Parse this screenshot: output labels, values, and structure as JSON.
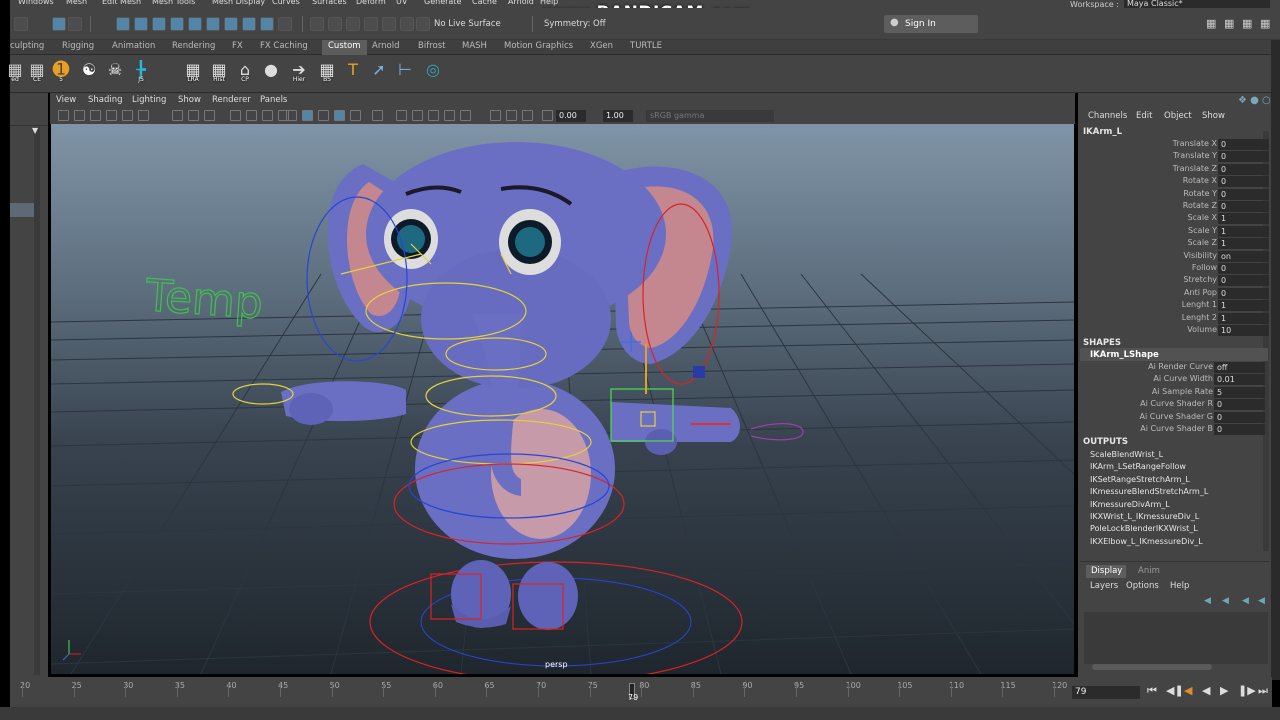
{
  "menu_bar": [
    "Windows",
    "Mesh",
    "Edit Mesh",
    "Mesh Tools",
    "Mesh Display",
    "Curves",
    "Surfaces",
    "Deform",
    "UV",
    "Generate",
    "Cache",
    "Arnold",
    "Help"
  ],
  "watermark": "www.BANDICAM.com",
  "workspace": {
    "label": "Workspace :",
    "value": "Maya Classic*"
  },
  "status_line": {
    "live_surface": "No Live Surface",
    "symmetry": "Symmetry: Off",
    "sign_in": "Sign In"
  },
  "shelf_tabs": [
    "culpting",
    "Rigging",
    "Animation",
    "Rendering",
    "FX",
    "FX Caching",
    "Custom",
    "Arnold",
    "Bifrost",
    "MASH",
    "Motion Graphics",
    "XGen",
    "TURTLE"
  ],
  "active_shelf": "Custom",
  "shelf_items": [
    {
      "label": "ed",
      "icon": "edit-icon"
    },
    {
      "label": "CE",
      "icon": "ce-icon"
    },
    {
      "label": "5",
      "icon": "five-circle-icon"
    },
    {
      "label": "",
      "icon": "t-pose-icon"
    },
    {
      "label": "",
      "icon": "skull-icon"
    },
    {
      "label": "JS",
      "icon": "joint-size-icon"
    },
    {
      "label": "LRA",
      "icon": "local-rotation-axes-icon"
    },
    {
      "label": "Hist",
      "icon": "history-icon"
    },
    {
      "label": "CP",
      "icon": "control-pivot-icon"
    },
    {
      "label": "",
      "icon": "person-icon"
    },
    {
      "label": "Hier",
      "icon": "hierarchy-icon"
    },
    {
      "label": "BS",
      "icon": "blendshape-icon"
    },
    {
      "label": "",
      "icon": "text-t-icon"
    },
    {
      "label": "",
      "icon": "pen-icon"
    },
    {
      "label": "",
      "icon": "align-icon"
    },
    {
      "label": "",
      "icon": "circle-target-icon"
    }
  ],
  "viewport": {
    "menus": [
      "View",
      "Shading",
      "Lighting",
      "Show",
      "Renderer",
      "Panels"
    ],
    "near": "0.00",
    "far": "1.00",
    "color_space": "sRGB gamma",
    "camera": "persp",
    "scene_text": "Temp"
  },
  "channel_box": {
    "menus": [
      "Channels",
      "Edit",
      "Object",
      "Show"
    ],
    "node": "IKArm_L",
    "attributes": [
      {
        "name": "Translate X",
        "value": "0"
      },
      {
        "name": "Translate Y",
        "value": "0"
      },
      {
        "name": "Translate Z",
        "value": "0"
      },
      {
        "name": "Rotate X",
        "value": "0"
      },
      {
        "name": "Rotate Y",
        "value": "0"
      },
      {
        "name": "Rotate Z",
        "value": "0"
      },
      {
        "name": "Scale X",
        "value": "1"
      },
      {
        "name": "Scale Y",
        "value": "1"
      },
      {
        "name": "Scale Z",
        "value": "1"
      },
      {
        "name": "Visibility",
        "value": "on"
      },
      {
        "name": "Follow",
        "value": "0"
      },
      {
        "name": "Stretchy",
        "value": "0"
      },
      {
        "name": "Anti Pop",
        "value": "0"
      },
      {
        "name": "Lenght 1",
        "value": "1"
      },
      {
        "name": "Lenght 2",
        "value": "1"
      },
      {
        "name": "Volume",
        "value": "10"
      }
    ],
    "shapes_header": "SHAPES",
    "shape_node": "IKArm_LShape",
    "shape_attributes": [
      {
        "name": "Ai Render Curve",
        "value": "off"
      },
      {
        "name": "Ai Curve Width",
        "value": "0.01"
      },
      {
        "name": "Ai Sample Rate",
        "value": "5"
      },
      {
        "name": "Ai Curve Shader R",
        "value": "0"
      },
      {
        "name": "Ai Curve Shader G",
        "value": "0"
      },
      {
        "name": "Ai Curve Shader B",
        "value": "0"
      }
    ],
    "outputs_header": "OUTPUTS",
    "outputs": [
      "ScaleBlendWrist_L",
      "IKArm_LSetRangeFollow",
      "IKSetRangeStretchArm_L",
      "IKmessureBlendStretchArm_L",
      "IKmessureDivArm_L",
      "IKXWrist_L_IKmessureDiv_L",
      "PoleLockBlenderIKXWrist_L",
      "IKXElbow_L_IKmessureDiv_L"
    ]
  },
  "layer_editor": {
    "tabs": [
      "Display",
      "Anim"
    ],
    "active": "Display",
    "menus": [
      "Layers",
      "Options",
      "Help"
    ]
  },
  "timeline": {
    "ticks": [
      "20",
      "25",
      "30",
      "35",
      "40",
      "45",
      "50",
      "55",
      "60",
      "65",
      "70",
      "75",
      "80",
      "85",
      "90",
      "95",
      "100",
      "105",
      "110",
      "115",
      "120"
    ],
    "current_frame": "79"
  },
  "colors": {
    "accent": "#5285a6",
    "background": "#444444",
    "viewport_top": "#7f94a6",
    "viewport_bottom": "#1f262d",
    "elephant": "#6a6fc4"
  }
}
